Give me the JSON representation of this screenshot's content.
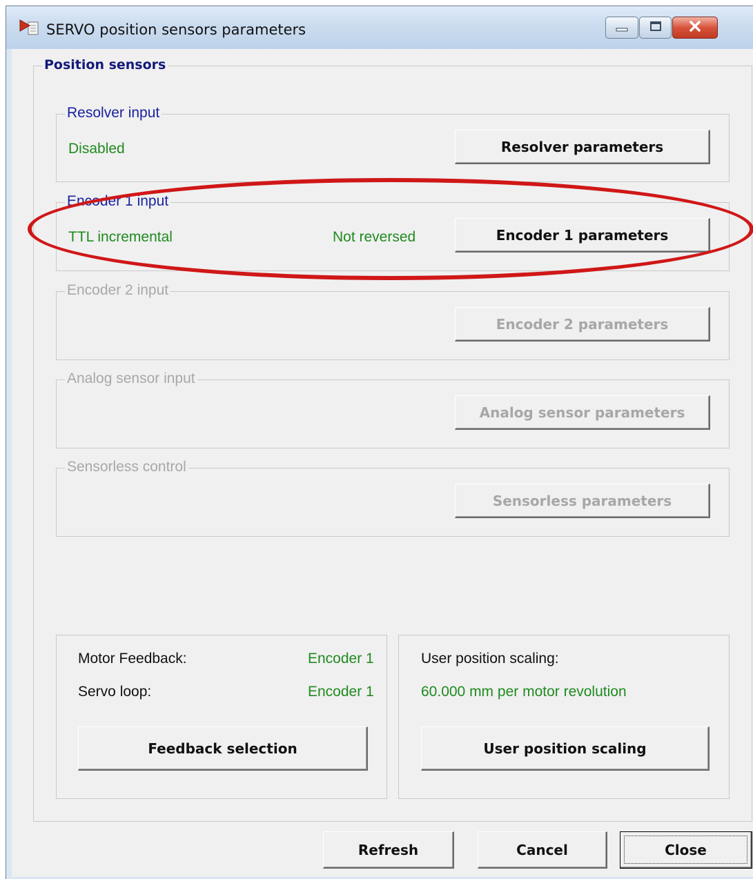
{
  "window": {
    "title": "SERVO position sensors parameters",
    "icon": "play-arrow-icon",
    "controls": [
      "minimize-icon",
      "maximize-icon",
      "close-icon"
    ]
  },
  "position_sensors": {
    "title": "Position sensors",
    "resolver": {
      "title": "Resolver input",
      "status": "Disabled",
      "button": "Resolver parameters"
    },
    "encoder1": {
      "title": "Encoder 1 input",
      "type": "TTL incremental",
      "direction": "Not reversed",
      "button": "Encoder 1 parameters"
    },
    "encoder2": {
      "title": "Encoder 2 input",
      "button": "Encoder 2 parameters"
    },
    "analog": {
      "title": "Analog sensor input",
      "button": "Analog sensor parameters"
    },
    "sensorless": {
      "title": "Sensorless control",
      "button": "Sensorless parameters"
    }
  },
  "feedback": {
    "motor_feedback_label": "Motor Feedback:",
    "motor_feedback_value": "Encoder 1",
    "servo_loop_label": "Servo loop:",
    "servo_loop_value": "Encoder 1",
    "button": "Feedback selection"
  },
  "scaling": {
    "label": "User position scaling:",
    "value": "60.000 mm per motor revolution",
    "button": "User position scaling"
  },
  "footer": {
    "refresh": "Refresh",
    "cancel": "Cancel",
    "close": "Close"
  },
  "colors": {
    "status_green": "#1f8a1f",
    "group_title_blue": "#1a22a0",
    "annotation_red": "#d01717",
    "disabled_gray": "#a7a7a7"
  }
}
